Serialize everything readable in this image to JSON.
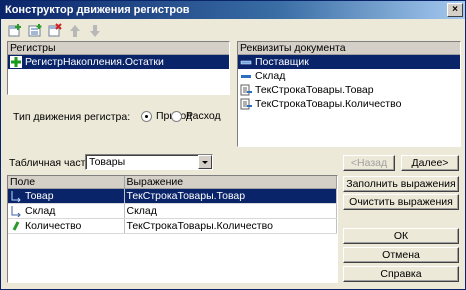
{
  "window": {
    "title": "Конструктор движения регистров"
  },
  "registers_panel": {
    "header": "Регистры",
    "items": [
      {
        "label": "РегистрНакопления.Остатки",
        "icon": "green-plus-register-icon"
      }
    ]
  },
  "requisites_panel": {
    "header": "Реквизиты документа",
    "items": [
      {
        "label": "Поставщик",
        "icon": "attribute-icon"
      },
      {
        "label": "Склад",
        "icon": "attribute-icon"
      },
      {
        "label": "ТекСтрокаТовары.Товар",
        "icon": "tabular-attribute-icon"
      },
      {
        "label": "ТекСтрокаТовары.Количество",
        "icon": "tabular-attribute-icon"
      }
    ]
  },
  "movement_type": {
    "label": "Тип движения регистра:",
    "options": [
      "Приход",
      "Расход"
    ],
    "selected": "Приход"
  },
  "tabular_part": {
    "label": "Табличная часть:",
    "value": "Товары"
  },
  "grid": {
    "columns": [
      "Поле",
      "Выражение"
    ],
    "rows": [
      {
        "field": "Товар",
        "expression": "ТекСтрокаТовары.Товар"
      },
      {
        "field": "Склад",
        "expression": "Склад"
      },
      {
        "field": "Количество",
        "expression": "ТекСтрокаТовары.Количество"
      }
    ]
  },
  "buttons": {
    "back": "<Назад",
    "next": "Далее>",
    "fill": "Заполнить выражения",
    "clear": "Очистить выражения",
    "ok": "ОК",
    "cancel": "Отмена",
    "help": "Справка"
  },
  "colors": {
    "selection": "#0a246a",
    "face": "#ece9d8",
    "title_start": "#0a246a"
  }
}
